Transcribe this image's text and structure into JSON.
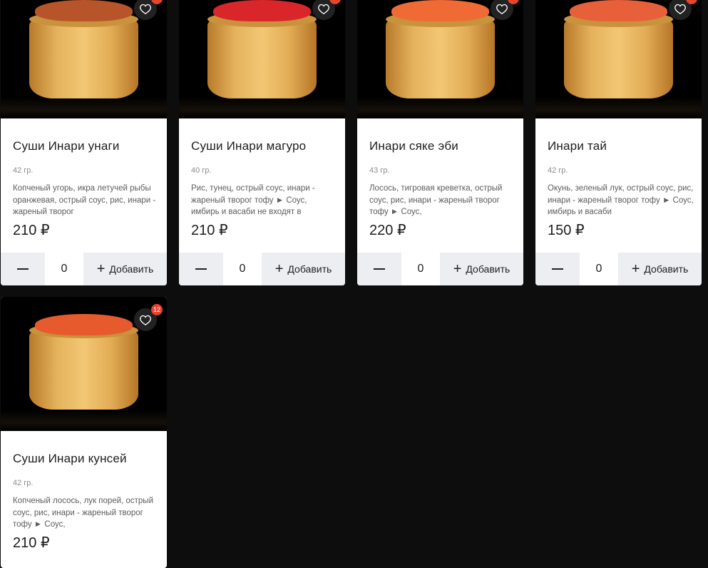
{
  "currency": "₽",
  "add_label": "Добавить",
  "products": [
    {
      "title": "Суши Инари унаги",
      "weight": "42 гр.",
      "description": "Копченый угорь, икра летучей рыбы оранжевая, острый соус, рис, инари - жареный творог",
      "price": "210 ₽",
      "quantity": "0",
      "filling_color": "#b8542a"
    },
    {
      "title": "Суши Инари магуро",
      "weight": "40 гр.",
      "description": "Рис, тунец, острый соус, инари - жареный творог тофу ► Соус, имбирь и васаби не входят в",
      "price": "210 ₽",
      "quantity": "0",
      "filling_color": "#d9262a"
    },
    {
      "title": "Инари сяке эби",
      "weight": "43 гр.",
      "description": "Лосось, тигровая креветка, острый соус, рис, инари - жареный творог тофу ► Соус,",
      "price": "220 ₽",
      "quantity": "0",
      "filling_color": "#ef6a35"
    },
    {
      "title": "Инари тай",
      "weight": "42 гр.",
      "description": "Окунь, зеленый лук, острый соус, рис, инари - жареный творог тофу ► Соус, имбирь и васаби",
      "price": "150 ₽",
      "quantity": "0",
      "filling_color": "#e8603a"
    },
    {
      "title": "Суши Инари кунсей",
      "weight": "42 гр.",
      "description": "Копченый лосось, лук порей, острый соус,  рис, инари - жареный творог тофу ► Соус,",
      "price": "210 ₽",
      "quantity": "0",
      "favorite_count": "12",
      "filling_color": "#e65a2e"
    }
  ]
}
